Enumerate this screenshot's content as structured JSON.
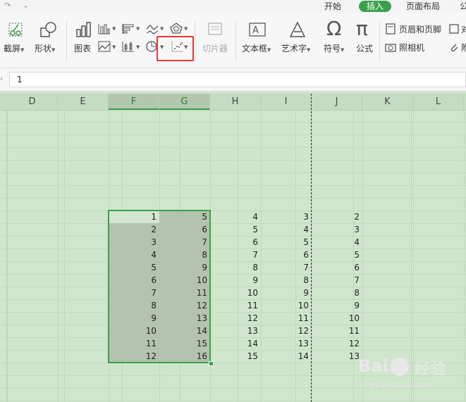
{
  "tabs": [
    "开始",
    "插入",
    "页面布局",
    "公"
  ],
  "active_tab": "插入",
  "ribbon": {
    "screenshot": "截屏",
    "shapes": "形状",
    "chart": "图表",
    "slicer": "切片器",
    "textbox": "文本框",
    "wordart": "艺术字",
    "symbol": "符号",
    "formula": "公式",
    "header_footer": "页眉和页脚",
    "camera": "照相机",
    "obj_partial": "对",
    "attach_partial": "附"
  },
  "formula_bar": {
    "value": "1"
  },
  "columns": [
    "D",
    "E",
    "F",
    "G",
    "H",
    "I",
    "J",
    "K",
    "L"
  ],
  "selected_columns": [
    "F",
    "G"
  ],
  "table": {
    "F": [
      1,
      2,
      3,
      4,
      5,
      6,
      7,
      8,
      9,
      10,
      11,
      12
    ],
    "G": [
      5,
      6,
      7,
      8,
      9,
      10,
      11,
      12,
      13,
      14,
      15,
      16
    ],
    "H": [
      4,
      5,
      6,
      7,
      8,
      9,
      10,
      11,
      12,
      13,
      14,
      15
    ],
    "I": [
      3,
      4,
      5,
      6,
      7,
      8,
      9,
      10,
      11,
      12,
      13,
      14
    ],
    "J": [
      2,
      3,
      4,
      5,
      6,
      7,
      8,
      9,
      10,
      11,
      12,
      13
    ]
  },
  "watermark": {
    "brand": "Bai",
    "cn": "经验",
    "url": "jingyan.baidu.com"
  }
}
